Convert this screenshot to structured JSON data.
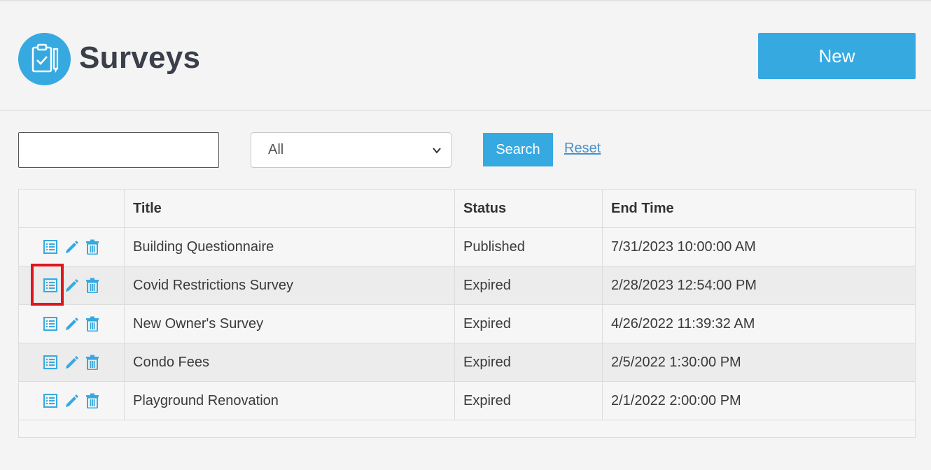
{
  "header": {
    "title": "Surveys",
    "new_button": "New",
    "logo_icon": "clipboard-check-icon"
  },
  "filters": {
    "search_value": "",
    "status_selected": "All",
    "search_button": "Search",
    "reset_link": "Reset"
  },
  "table": {
    "columns": [
      "",
      "Title",
      "Status",
      "End Time"
    ],
    "rows": [
      {
        "title": "Building Questionnaire",
        "status": "Published",
        "end_time": "7/31/2023 10:00:00 AM"
      },
      {
        "title": "Covid Restrictions Survey",
        "status": "Expired",
        "end_time": "2/28/2023 12:54:00 PM"
      },
      {
        "title": "New Owner's Survey",
        "status": "Expired",
        "end_time": "4/26/2022 11:39:32 AM"
      },
      {
        "title": "Condo Fees",
        "status": "Expired",
        "end_time": "2/5/2022 1:30:00 PM"
      },
      {
        "title": "Playground Renovation",
        "status": "Expired",
        "end_time": "2/1/2022 2:00:00 PM"
      }
    ],
    "action_icons": [
      "results-list-icon",
      "edit-pencil-icon",
      "delete-trash-icon"
    ]
  },
  "colors": {
    "accent": "#36a9e1",
    "link": "#4a90c9",
    "highlight": "#e0161d"
  }
}
